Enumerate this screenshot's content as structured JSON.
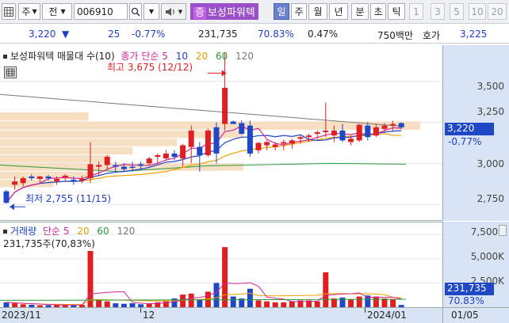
{
  "toolbar": {
    "market": "주",
    "prev_label": "전",
    "code": "006910",
    "stock_badge": "증",
    "stock_name": "보성파워텍",
    "periods": [
      "일",
      "주",
      "월",
      "년",
      "분",
      "초",
      "틱"
    ],
    "active_period": "일",
    "minute_values": [
      "1",
      "3",
      "5",
      "10",
      "20"
    ]
  },
  "quote": {
    "price": "3,220",
    "change": "25",
    "change_rate": "-0.77%",
    "volume": "231,735",
    "vol_ratio": "70.83%",
    "turnover": "0.47%",
    "amount": "750백만",
    "ask_label": "호가",
    "ask_price": "3,225"
  },
  "price_panel": {
    "legend_name": "보성파워텍 매물대 수(10)",
    "legend_ma_label": "종가 단순 5",
    "legend_ma_periods": [
      "10",
      "20",
      "60",
      "120"
    ],
    "high_label": "최고 3,675 (12/12)",
    "low_label": "최저 2,755 (11/15)",
    "y_ticks": [
      "3,500",
      "3,250",
      "3,000",
      "2,750"
    ],
    "current_tag": "3,220",
    "current_change": "-0.77%"
  },
  "volume_panel": {
    "legend_name": "거래량",
    "legend_ma_label": "단순 5",
    "legend_ma_periods": [
      "20",
      "60",
      "120"
    ],
    "volume_text": "231,735주(70,83%)",
    "y_ticks": [
      "7,500K",
      "5,000K",
      "2,500K"
    ],
    "current_tag": "231,735",
    "current_ratio": "70.83%"
  },
  "x_axis": {
    "labels": [
      "2023/11",
      "12",
      "2024/01"
    ],
    "right_label": "01/05"
  },
  "colors": {
    "up": "#e02020",
    "down": "#1f47c6",
    "ma5": "#d6249a",
    "ma10": "#1f3fc9",
    "ma20": "#f0a000",
    "ma60": "#2a9a3a",
    "ma120": "#777777",
    "axis_bg": "#d8e4f3",
    "volume_profile": "#f6d9b8"
  },
  "chart_data": {
    "type": "candlestick",
    "ylim_price": [
      2650,
      3720
    ],
    "ylim_volume": [
      0,
      8500000
    ],
    "candles": [
      {
        "o": 2830,
        "h": 2840,
        "l": 2755,
        "c": 2760,
        "v": 500000
      },
      {
        "o": 2870,
        "h": 2920,
        "l": 2840,
        "c": 2890,
        "v": 400000
      },
      {
        "o": 2880,
        "h": 2920,
        "l": 2860,
        "c": 2910,
        "v": 300000
      },
      {
        "o": 2920,
        "h": 2935,
        "l": 2895,
        "c": 2910,
        "v": 250000
      },
      {
        "o": 2905,
        "h": 2925,
        "l": 2880,
        "c": 2920,
        "v": 200000
      },
      {
        "o": 2920,
        "h": 2930,
        "l": 2895,
        "c": 2910,
        "v": 200000
      },
      {
        "o": 2890,
        "h": 2920,
        "l": 2870,
        "c": 2905,
        "v": 250000
      },
      {
        "o": 2915,
        "h": 2935,
        "l": 2895,
        "c": 2925,
        "v": 200000
      },
      {
        "o": 2900,
        "h": 2920,
        "l": 2870,
        "c": 2890,
        "v": 200000
      },
      {
        "o": 2895,
        "h": 2925,
        "l": 2880,
        "c": 2905,
        "v": 250000
      },
      {
        "o": 2910,
        "h": 3130,
        "l": 2880,
        "c": 2995,
        "v": 5800000
      },
      {
        "o": 2980,
        "h": 3010,
        "l": 2930,
        "c": 2990,
        "v": 800000
      },
      {
        "o": 2990,
        "h": 3050,
        "l": 2960,
        "c": 3040,
        "v": 600000
      },
      {
        "o": 2990,
        "h": 3010,
        "l": 2950,
        "c": 2980,
        "v": 400000
      },
      {
        "o": 2980,
        "h": 3000,
        "l": 2950,
        "c": 2965,
        "v": 350000
      },
      {
        "o": 2980,
        "h": 3010,
        "l": 2950,
        "c": 2975,
        "v": 400000
      },
      {
        "o": 2995,
        "h": 3010,
        "l": 2965,
        "c": 2985,
        "v": 300000
      },
      {
        "o": 3000,
        "h": 3040,
        "l": 2985,
        "c": 3030,
        "v": 400000
      },
      {
        "o": 3040,
        "h": 3060,
        "l": 3000,
        "c": 3050,
        "v": 500000
      },
      {
        "o": 3030,
        "h": 3080,
        "l": 3020,
        "c": 3060,
        "v": 600000
      },
      {
        "o": 3060,
        "h": 3080,
        "l": 3020,
        "c": 3040,
        "v": 900000
      },
      {
        "o": 3030,
        "h": 3120,
        "l": 2980,
        "c": 3110,
        "v": 1300000
      },
      {
        "o": 3100,
        "h": 3230,
        "l": 3000,
        "c": 3200,
        "v": 1400000
      },
      {
        "o": 3100,
        "h": 3130,
        "l": 2950,
        "c": 3050,
        "v": 800000
      },
      {
        "o": 3050,
        "h": 3210,
        "l": 3040,
        "c": 3200,
        "v": 1600000
      },
      {
        "o": 3220,
        "h": 3250,
        "l": 3000,
        "c": 3060,
        "v": 2500000
      },
      {
        "o": 3240,
        "h": 3675,
        "l": 3200,
        "c": 3460,
        "v": 6200000
      },
      {
        "o": 3255,
        "h": 3260,
        "l": 3240,
        "c": 3240,
        "v": 1100000
      },
      {
        "o": 3245,
        "h": 3260,
        "l": 3175,
        "c": 3180,
        "v": 900000
      },
      {
        "o": 3230,
        "h": 3260,
        "l": 3040,
        "c": 3060,
        "v": 1900000
      },
      {
        "o": 3080,
        "h": 3130,
        "l": 3060,
        "c": 3125,
        "v": 700000
      },
      {
        "o": 3110,
        "h": 3140,
        "l": 3080,
        "c": 3130,
        "v": 600000
      },
      {
        "o": 3100,
        "h": 3130,
        "l": 3080,
        "c": 3115,
        "v": 500000
      },
      {
        "o": 3120,
        "h": 3145,
        "l": 3080,
        "c": 3130,
        "v": 500000
      },
      {
        "o": 3120,
        "h": 3150,
        "l": 3090,
        "c": 3140,
        "v": 600000
      },
      {
        "o": 3150,
        "h": 3170,
        "l": 3120,
        "c": 3160,
        "v": 700000
      },
      {
        "o": 3160,
        "h": 3180,
        "l": 3130,
        "c": 3170,
        "v": 700000
      },
      {
        "o": 3180,
        "h": 3200,
        "l": 3150,
        "c": 3190,
        "v": 600000
      },
      {
        "o": 3190,
        "h": 3370,
        "l": 3160,
        "c": 3200,
        "v": 3600000
      },
      {
        "o": 3170,
        "h": 3230,
        "l": 3130,
        "c": 3200,
        "v": 900000
      },
      {
        "o": 3200,
        "h": 3240,
        "l": 3130,
        "c": 3140,
        "v": 1000000
      },
      {
        "o": 3130,
        "h": 3170,
        "l": 3110,
        "c": 3150,
        "v": 800000
      },
      {
        "o": 3140,
        "h": 3240,
        "l": 3130,
        "c": 3235,
        "v": 1100000
      },
      {
        "o": 3230,
        "h": 3250,
        "l": 3140,
        "c": 3160,
        "v": 1200000
      },
      {
        "o": 3170,
        "h": 3240,
        "l": 3160,
        "c": 3220,
        "v": 1100000
      },
      {
        "o": 3210,
        "h": 3245,
        "l": 3190,
        "c": 3230,
        "v": 900000
      },
      {
        "o": 3230,
        "h": 3260,
        "l": 3200,
        "c": 3240,
        "v": 800000
      },
      {
        "o": 3245,
        "h": 3250,
        "l": 3210,
        "c": 3220,
        "v": 231735
      }
    ]
  }
}
